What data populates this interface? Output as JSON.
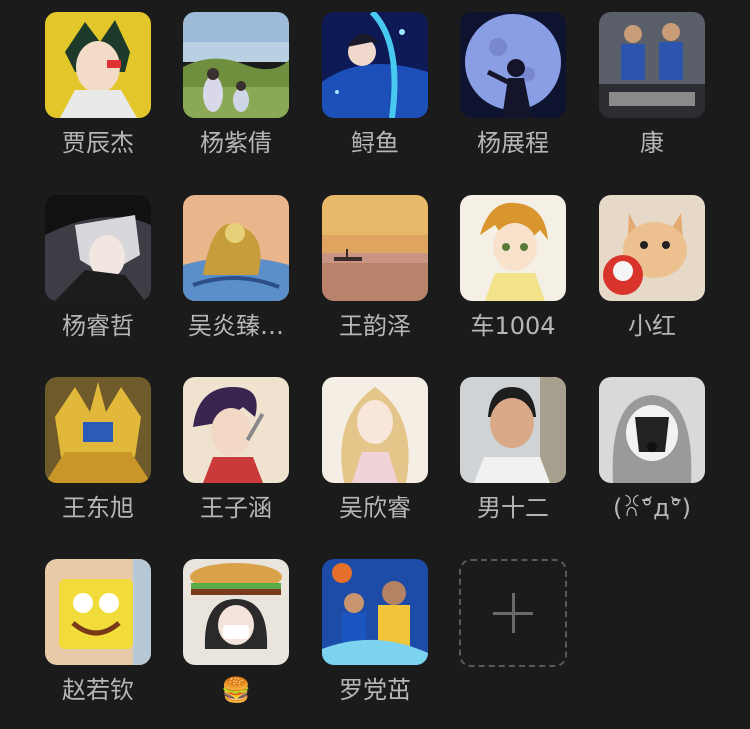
{
  "members": [
    {
      "name": "贾辰杰",
      "avatar": "anime-green-hair"
    },
    {
      "name": "杨紫倩",
      "avatar": "landscape-people"
    },
    {
      "name": "鲟鱼",
      "avatar": "anime-blue-art"
    },
    {
      "name": "杨展程",
      "avatar": "moon-silhouette"
    },
    {
      "name": "康",
      "avatar": "basketball-players"
    },
    {
      "name": "杨睿哲",
      "avatar": "anime-white-hair"
    },
    {
      "name": "吴炎臻…",
      "avatar": "dragon-art"
    },
    {
      "name": "王韵泽",
      "avatar": "sunset-boat"
    },
    {
      "name": "车1004",
      "avatar": "anime-boy"
    },
    {
      "name": "小红",
      "avatar": "cat-photo"
    },
    {
      "name": "王东旭",
      "avatar": "gold-mecha"
    },
    {
      "name": "王子涵",
      "avatar": "anime-purple-hair"
    },
    {
      "name": "吴欣睿",
      "avatar": "anime-blonde-girl"
    },
    {
      "name": "男十二",
      "avatar": "boy-photo"
    },
    {
      "name": "(ꐦ°᷄д°᷅)",
      "avatar": "dog-hoodie"
    },
    {
      "name": "赵若钦",
      "avatar": "spongebob"
    },
    {
      "name": "🍔",
      "avatar": "burger-girl"
    },
    {
      "name": "罗党茁",
      "avatar": "basketball-poster"
    }
  ],
  "add_button": {
    "icon": "plus-icon"
  },
  "colors": {
    "background": "#1b1b1b",
    "name_text": "#b6b6b6",
    "add_border": "#5a5a5a"
  }
}
